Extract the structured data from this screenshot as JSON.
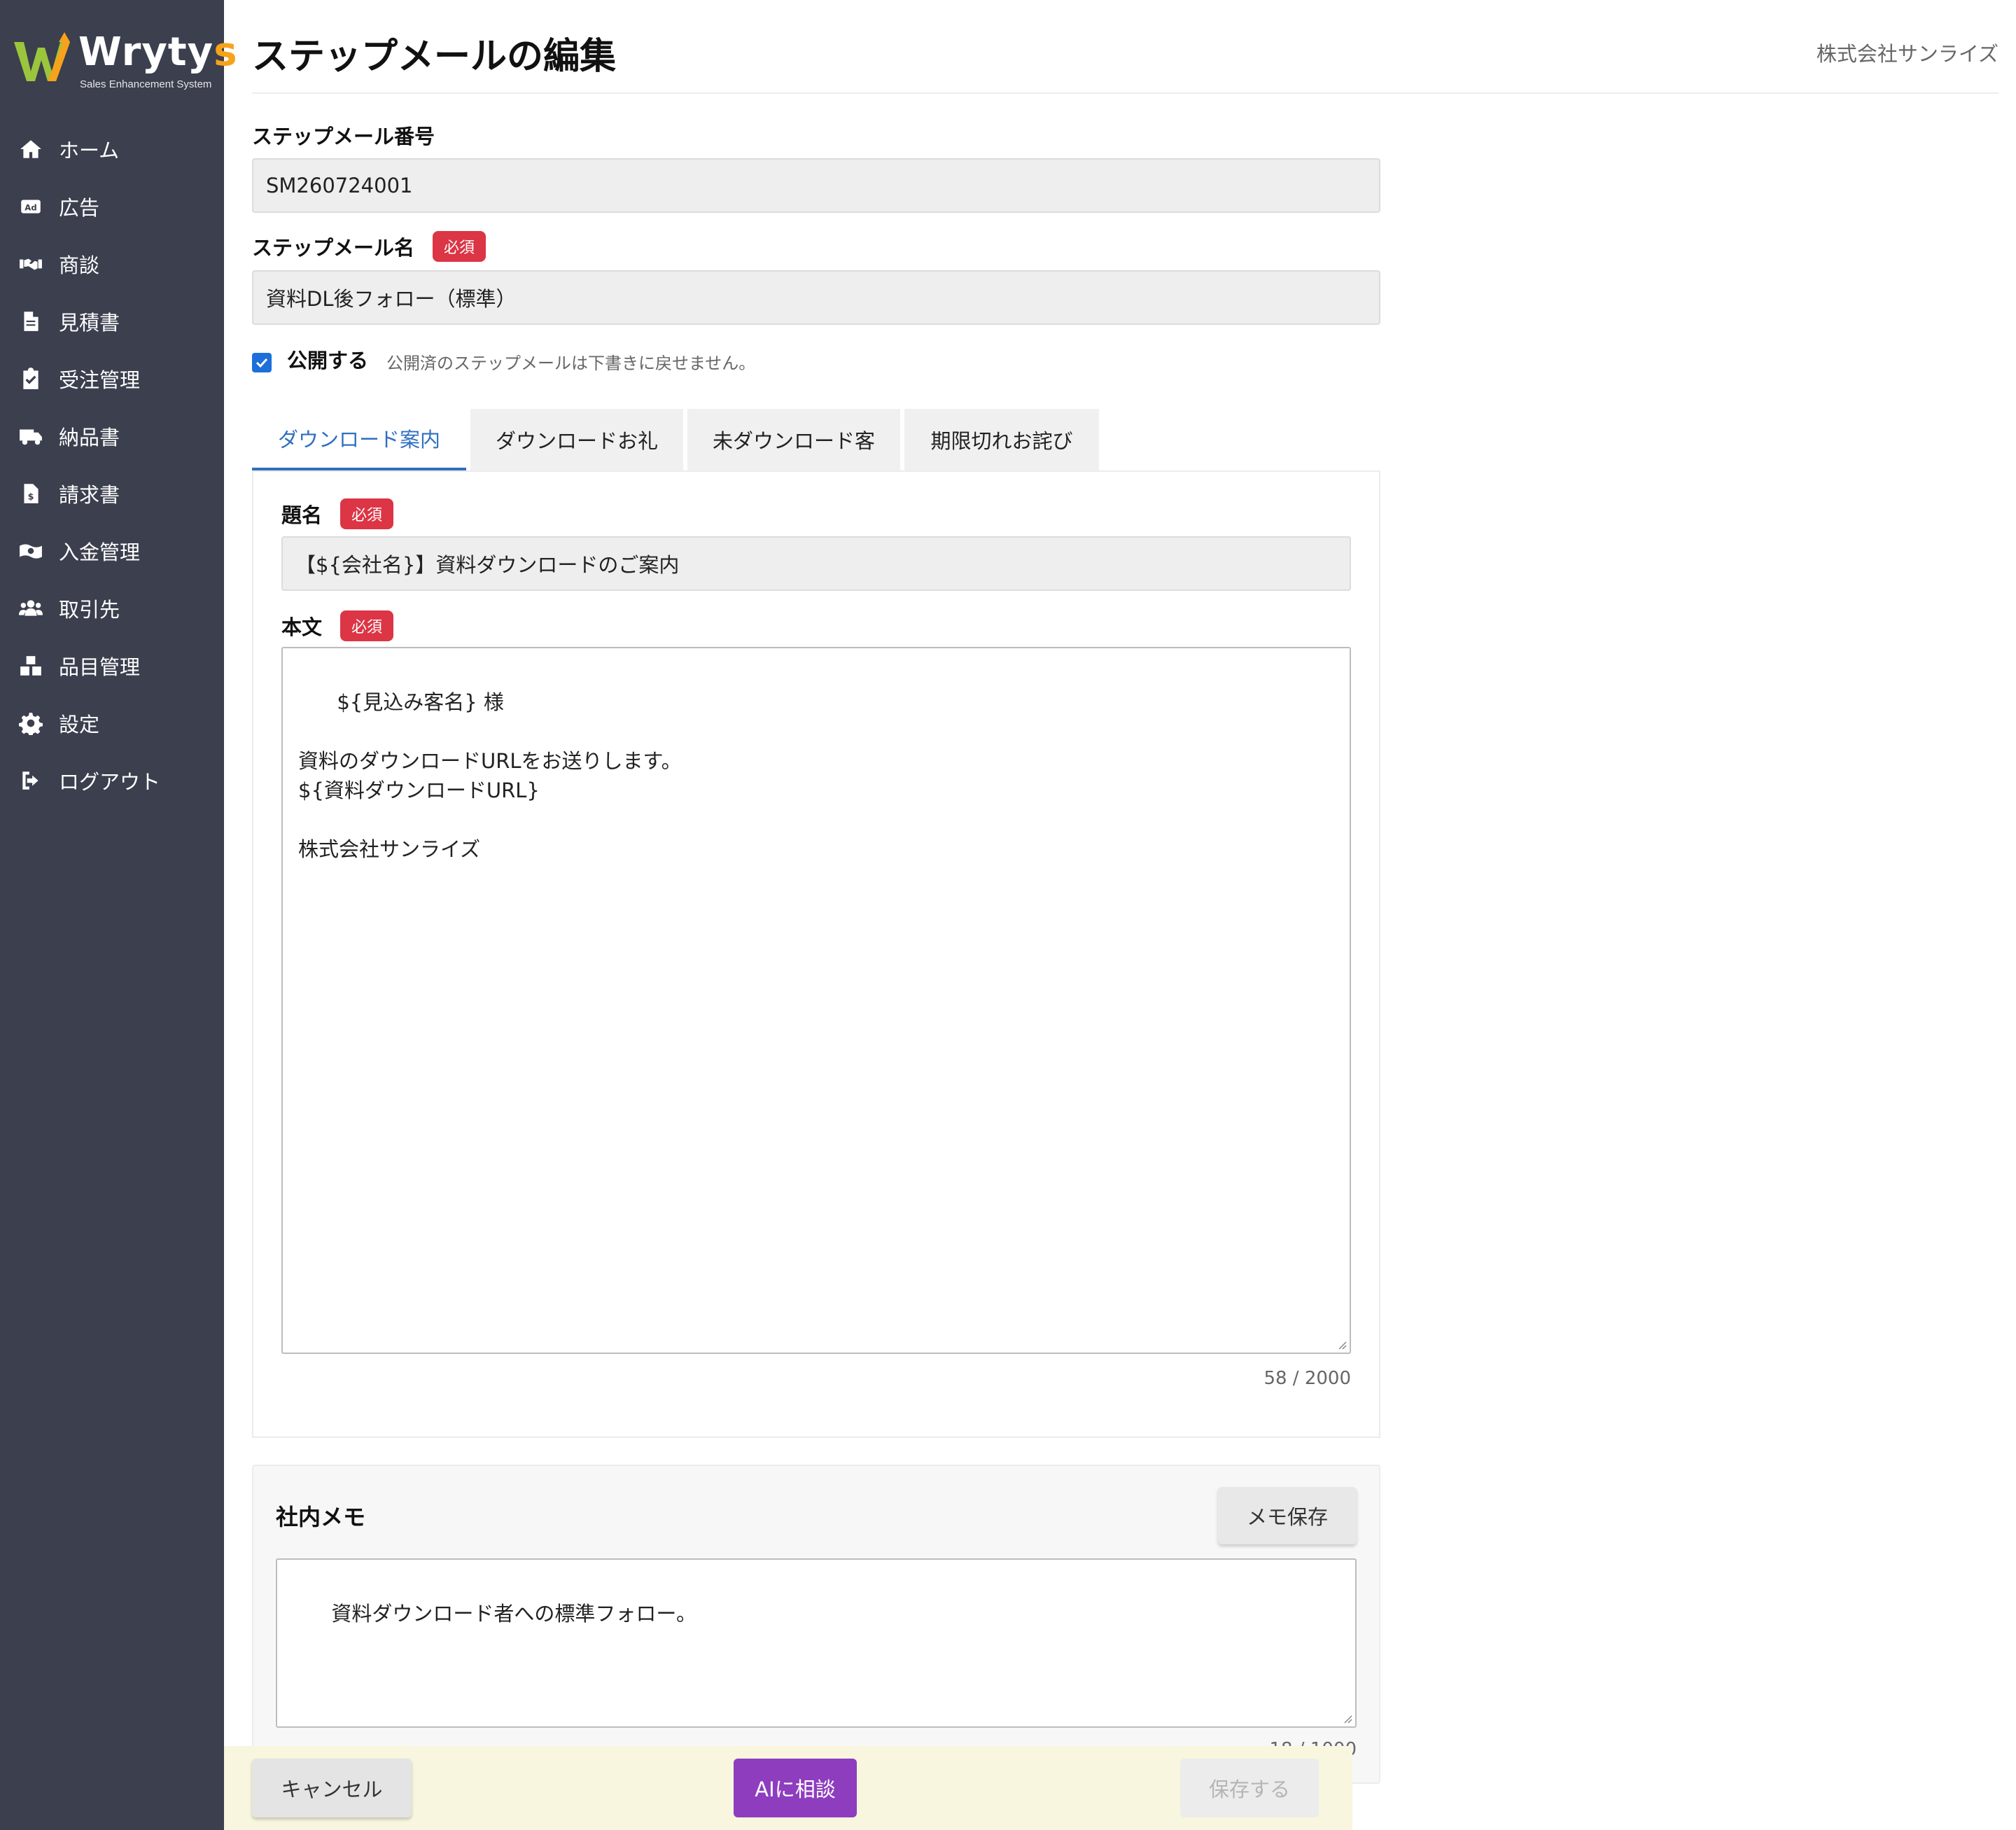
{
  "brand": {
    "name_main": "Wryty",
    "name_accent": "s",
    "tagline": "Sales Enhancement System"
  },
  "sidebar": {
    "items": [
      {
        "label": "ホーム",
        "icon": "home-icon"
      },
      {
        "label": "広告",
        "icon": "ad-icon"
      },
      {
        "label": "商談",
        "icon": "handshake-icon"
      },
      {
        "label": "見積書",
        "icon": "document-icon"
      },
      {
        "label": "受注管理",
        "icon": "clipboard-check-icon"
      },
      {
        "label": "納品書",
        "icon": "truck-icon"
      },
      {
        "label": "請求書",
        "icon": "invoice-icon"
      },
      {
        "label": "入金管理",
        "icon": "money-icon"
      },
      {
        "label": "取引先",
        "icon": "users-icon"
      },
      {
        "label": "品目管理",
        "icon": "boxes-icon"
      },
      {
        "label": "設定",
        "icon": "gear-icon"
      },
      {
        "label": "ログアウト",
        "icon": "logout-icon"
      }
    ]
  },
  "header": {
    "title": "ステップメールの編集",
    "company": "株式会社サンライズ"
  },
  "form": {
    "number_label": "ステップメール番号",
    "number_value": "SM260724001",
    "name_label": "ステップメール名",
    "required_badge": "必須",
    "name_value": "資料DL後フォロー（標準）",
    "publish_label": "公開する",
    "publish_checked": true,
    "publish_note": "公開済のステップメールは下書きに戻せません。"
  },
  "tabs": [
    {
      "label": "ダウンロード案内",
      "active": true
    },
    {
      "label": "ダウンロードお礼",
      "active": false
    },
    {
      "label": "未ダウンロード客",
      "active": false
    },
    {
      "label": "期限切れお詫び",
      "active": false
    }
  ],
  "mail": {
    "subject_label": "題名",
    "subject_value": "【${会社名}】資料ダウンロードのご案内",
    "body_label": "本文",
    "body_value": "${見込み客名} 様\n\n資料のダウンロードURLをお送りします。\n${資料ダウンロードURL}\n\n株式会社サンライズ",
    "body_counter": "58 / 2000"
  },
  "memo": {
    "title": "社内メモ",
    "save_label": "メモ保存",
    "value": "資料ダウンロード者への標準フォロー。",
    "counter": "18 / 1000"
  },
  "actions": {
    "cancel_label": "キャンセル",
    "ai_label": "AIに相談",
    "save_label": "保存する"
  },
  "colors": {
    "sidebar_bg": "#3b3f4e",
    "accent_blue": "#2f6fc0",
    "required_red": "#dc3545",
    "ai_purple": "#8e3dbf",
    "bottom_bar_bg": "#f8f6df"
  }
}
